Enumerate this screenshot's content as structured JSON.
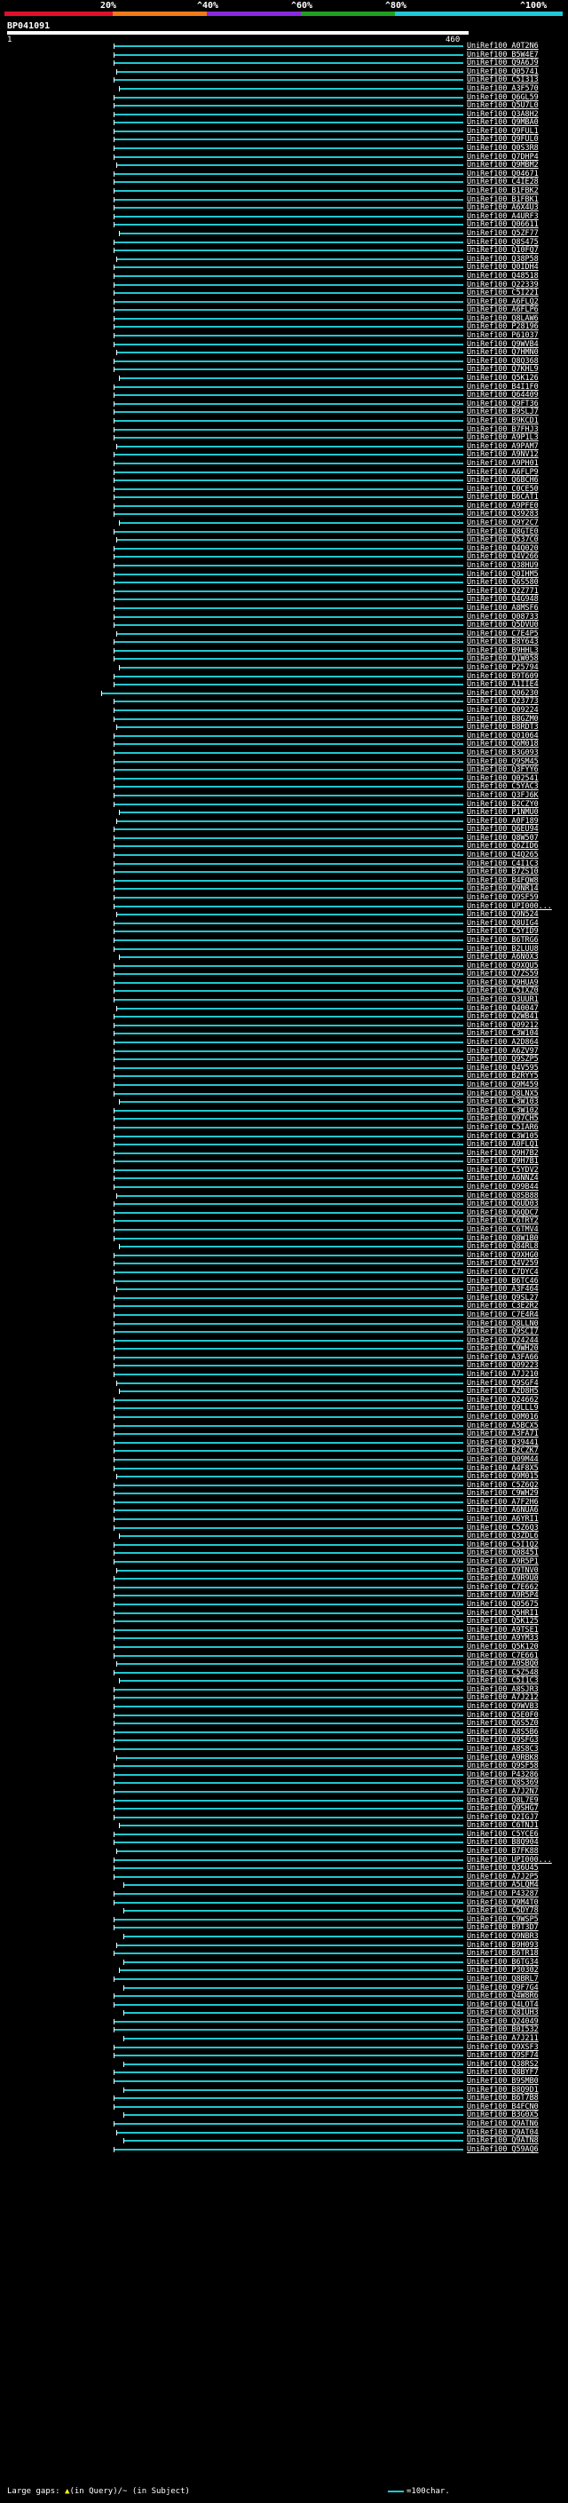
{
  "legend": {
    "segments": [
      {
        "color": "#e0102a"
      },
      {
        "color": "#f07a18"
      },
      {
        "color": "#8a2ae0"
      },
      {
        "color": "#20a020"
      },
      {
        "color": "#20c8d8"
      }
    ],
    "labels": [
      "20%",
      "^40%",
      "^60%",
      "^80%",
      "^100%"
    ]
  },
  "query": {
    "name": "BP041091",
    "start": "1",
    "end": "460"
  },
  "hit_color": "#20c8d0",
  "hits": [
    "UniRef100_A0T2N6",
    "UniRef100_B5W4E7",
    "UniRef100_Q9A6J9",
    "UniRef100_Q05741",
    "UniRef100_C5I313",
    "UniRef100_A3F570",
    "UniRef100_Q6GL59",
    "UniRef100_Q5U7L0",
    "UniRef100_Q3A8H2",
    "UniRef100_Q9MBA0",
    "UniRef100_Q9FUL1",
    "UniRef100_Q9FUL0",
    "UniRef100_Q0S3R8",
    "UniRef100_Q7DHP4",
    "UniRef100_Q9MBM2",
    "UniRef100_Q04671",
    "UniRef100_C4IE28",
    "UniRef100_B1FBK2",
    "UniRef100_B1FBK1",
    "UniRef100_A6X4U3",
    "UniRef100_A4URF3",
    "UniRef100_Q06611",
    "UniRef100_Q5ZF77",
    "UniRef100_Q8S475",
    "UniRef100_Q10FQ7",
    "UniRef100_Q38P58",
    "UniRef100_Q0IDH4",
    "UniRef100_Q48518",
    "UniRef100_Q22339",
    "UniRef100_C5I221",
    "UniRef100_A6FLQ2",
    "UniRef100_A6FLP6",
    "UniRef100_Q8LAW6",
    "UniRef100_P28196",
    "UniRef100_P61037",
    "UniRef100_Q9WVB4",
    "UniRef100_Q7HMN0",
    "UniRef100_Q8Q368",
    "UniRef100_Q7KHL9",
    "UniRef100_Q5K126",
    "UniRef100_B4I1F0",
    "UniRef100_Q64409",
    "UniRef100_Q9FT36",
    "UniRef100_B9SLJ7",
    "UniRef100_B9KCD1",
    "UniRef100_B7FHJ3",
    "UniRef100_A9P1L3",
    "UniRef100_A9PAM7",
    "UniRef100_A9NV12",
    "UniRef100_A9PH01",
    "UniRef100_A6FLP9",
    "UniRef100_Q6BCH6",
    "UniRef100_C0CE50",
    "UniRef100_B6CAT1",
    "UniRef100_A9PFE0",
    "UniRef100_Q39283",
    "UniRef100_Q9Y2C7",
    "UniRef100_Q8GTE0",
    "UniRef100_Q537C0",
    "UniRef100_Q4Q020",
    "UniRef100_Q4V266",
    "UniRef100_Q38HU9",
    "UniRef100_Q0IHM5",
    "UniRef100_Q6S580",
    "UniRef100_Q2Z771",
    "UniRef100_Q4G948",
    "UniRef100_A8MSF6",
    "UniRef100_Q08733",
    "UniRef100_Q5DVU0",
    "UniRef100_C7E4P5",
    "UniRef100_B8Y643",
    "UniRef100_B9HHL3",
    "UniRef100_Q1W058",
    "UniRef100_P25794",
    "UniRef100_B9T609",
    "UniRef100_A1IIE4",
    "UniRef100_Q06230",
    "UniRef100_Q23773",
    "UniRef100_Q09224",
    "UniRef100_B8GZM0",
    "UniRef100_B8RDT3",
    "UniRef100_Q01064",
    "UniRef100_Q6M018",
    "UniRef100_B3G093",
    "UniRef100_Q9SM45",
    "UniRef100_Q3FYY6",
    "UniRef100_Q02541",
    "UniRef100_C5YAC3",
    "UniRef100_Q3FJ6K",
    "UniRef100_B2CZY0",
    "UniRef100_P1NMU0",
    "UniRef100_A0F189",
    "UniRef100_Q6EU94",
    "UniRef100_Q8W507",
    "UniRef100_Q6ZID6",
    "UniRef100_Q4Q265",
    "UniRef100_C4I1C3",
    "UniRef100_B7ZS10",
    "UniRef100_B4FQW8",
    "UniRef100_Q9NR14",
    "UniRef100_Q9SF59",
    "UniRef100_UPI000...",
    "UniRef100_Q9N524",
    "UniRef100_Q8UIG4",
    "UniRef100_C5YID9",
    "UniRef100_B6TRG6",
    "UniRef100_B2LUU8",
    "UniRef100_A6N0X3",
    "UniRef100_Q9XQU5",
    "UniRef100_Q7ZS59",
    "UniRef100_Q9HUA9",
    "UniRef100_C5IXZ0",
    "UniRef100_Q3UUR1",
    "UniRef100_Q40047",
    "UniRef100_Q2WB41",
    "UniRef100_Q09212",
    "UniRef100_C3W104",
    "UniRef100_A2D864",
    "UniRef100_A6ZV97",
    "UniRef100_Q9SZP5",
    "UniRef100_Q4V595",
    "UniRef100_B2RYY5",
    "UniRef100_Q9M459",
    "UniRef100_Q8LNX5",
    "UniRef100_C3W103",
    "UniRef100_C3W102",
    "UniRef100_Q97CH5",
    "UniRef100_C5IAR6",
    "UniRef100_C3W105",
    "UniRef100_A0FLQ1",
    "UniRef100_Q9H7B2",
    "UniRef100_Q9H7B1",
    "UniRef100_C5YDV2",
    "UniRef100_A6NNZ4",
    "UniRef100_Q99B44",
    "UniRef100_Q8SB88",
    "UniRef100_Q6UD03",
    "UniRef100_Q6QDC7",
    "UniRef100_C6TRY2",
    "UniRef100_C6TMV4",
    "UniRef100_Q8W1B0",
    "UniRef100_Q84RL8",
    "UniRef100_Q9XHG0",
    "UniRef100_Q4V259",
    "UniRef100_C7DYC4",
    "UniRef100_B6TC46",
    "UniRef100_A3F464",
    "UniRef100_Q9SL27",
    "UniRef100_C3E2R2",
    "UniRef100_C7E4R4",
    "UniRef100_Q8LLN0",
    "UniRef100_Q9SCI7",
    "UniRef100_Q24244",
    "UniRef100_C9WH20",
    "UniRef100_A3FA66",
    "UniRef100_Q09223",
    "UniRef100_A7J210",
    "UniRef100_Q9SGF4",
    "UniRef100_A2D8H5",
    "UniRef100_Q24662",
    "UniRef100_Q9LLL9",
    "UniRef100_Q0M016",
    "UniRef100_A5BCX5",
    "UniRef100_A3FA71",
    "UniRef100_Q39441",
    "UniRef100_B2CZK7",
    "UniRef100_Q09M44",
    "UniRef100_A4F8X5",
    "UniRef100_Q9M015",
    "UniRef100_C5Z6Q2",
    "UniRef100_C9WH29",
    "UniRef100_A7F2H6",
    "UniRef100_A6NUA6",
    "UniRef100_A6YRI1",
    "UniRef100_C5Z6Q3",
    "UniRef100_Q3ZDL6",
    "UniRef100_C5I1Q2",
    "UniRef100_Q08451",
    "UniRef100_A9R5P1",
    "UniRef100_Q9TNV0",
    "UniRef100_A9R9U0",
    "UniRef100_C7E662",
    "UniRef100_A9R5P4",
    "UniRef100_Q05675",
    "UniRef100_Q5HRI1",
    "UniRef100_Q5K125",
    "UniRef100_A9TSE1",
    "UniRef100_A9YM33",
    "UniRef100_Q5K120",
    "UniRef100_C7E661",
    "UniRef100_A0SBQ0",
    "UniRef100_C5Z548",
    "UniRef100_C5I1C3",
    "UniRef100_A8SJR3",
    "UniRef100_A7J212",
    "UniRef100_Q9WVB3",
    "UniRef100_Q5E0F0",
    "UniRef100_Q6S5Z0",
    "UniRef100_A8S5B6",
    "UniRef100_Q9SFG3",
    "UniRef100_A8S8C3",
    "UniRef100_A9RBK8",
    "UniRef100_Q9SF58",
    "UniRef100_P43286",
    "UniRef100_Q8S369",
    "UniRef100_A7J2N7",
    "UniRef100_Q8L7E9",
    "UniRef100_Q9SHG7",
    "UniRef100_Q2IGJ7",
    "UniRef100_C6TNJ1",
    "UniRef100_C5YCE6",
    "UniRef100_B8Q904",
    "UniRef100_B7FK88",
    "UniRef100_UPI000...",
    "UniRef100_Q36U45",
    "UniRef100_A7J2P5",
    "UniRef100_A5LQM4",
    "UniRef100_P43287",
    "UniRef100_Q9M4T0",
    "UniRef100_C5DY78",
    "UniRef100_C9WSP5",
    "UniRef100_B9T3D7",
    "UniRef100_Q9NBR3",
    "UniRef100_B9H093",
    "UniRef100_B6TR18",
    "UniRef100_B6TG34",
    "UniRef100_P30302",
    "UniRef100_Q8BRL7",
    "UniRef100_Q9F7G4",
    "UniRef100_Q4W8R6",
    "UniRef100_Q4LOT4",
    "UniRef100_Q8IUH3",
    "UniRef100_Q24049",
    "UniRef100_B0I532",
    "UniRef100_A7J211",
    "UniRef100_Q9XSF3",
    "UniRef100_Q9SF74",
    "UniRef100_Q38RS2",
    "UniRef100_Q8BYF7",
    "UniRef100_B9SMB0",
    "UniRef100_B8Q9D1",
    "UniRef100_B6T7B8",
    "UniRef100_B4FCN0",
    "UniRef100_B3G0X5",
    "UniRef100_Q9ATN6",
    "UniRef100_Q9AT04",
    "UniRef100_Q9ATN8",
    "UniRef100_Q59AQ6"
  ],
  "footer": {
    "large_gaps_label": "Large gaps:",
    "in_query": "(in Query)",
    "in_subject": "/~ (in Subject)",
    "scale_label": "=100char."
  }
}
